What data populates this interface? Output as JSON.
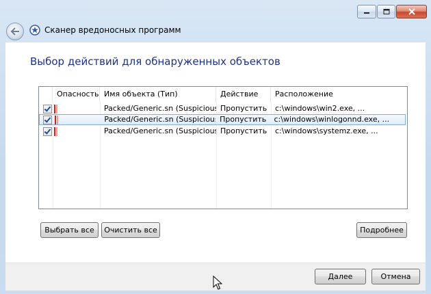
{
  "window": {
    "title": "Сканер вредоносных программ",
    "minimize_icon": "minimize-icon",
    "maximize_icon": "maximize-icon",
    "close_icon": "close-icon",
    "back_icon": "back-arrow-icon",
    "app_icon": "scanner-app-icon"
  },
  "page": {
    "heading": "Выбор действий для обнаруженных объектов"
  },
  "table": {
    "columns": [
      "",
      "Опасность",
      "Имя объекта (Тип)",
      "Действие",
      "Расположение"
    ],
    "rows": [
      {
        "checked": true,
        "severity_level": "high",
        "name": "Packed/Generic.sn (Suspicious)",
        "action": "Пропустить",
        "location": "c:\\windows\\win2.exe, ...",
        "selected": false
      },
      {
        "checked": true,
        "severity_level": "high",
        "name": "Packed/Generic.sn (Suspicious)",
        "action": "Пропустить",
        "location": "c:\\windows\\winlogonnd.exe, ...",
        "selected": true
      },
      {
        "checked": true,
        "severity_level": "high",
        "name": "Packed/Generic.sn (Suspicious)",
        "action": "Пропустить",
        "location": "c:\\windows\\systemz.exe, ...",
        "selected": false
      }
    ]
  },
  "buttons": {
    "select_all": "Выбрать все",
    "clear_all": "Очистить все",
    "details": "Подробнее",
    "next": "Далее",
    "cancel": "Отмена"
  },
  "colors": {
    "heading": "#1e3287",
    "danger": "#d21e1e",
    "selection_border": "#84acdd"
  }
}
